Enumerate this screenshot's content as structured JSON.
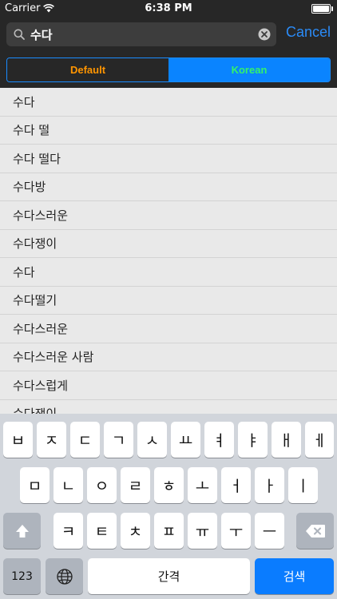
{
  "status_bar": {
    "carrier": "Carrier",
    "time": "6:38 PM"
  },
  "search": {
    "value": "수다",
    "cancel_label": "Cancel"
  },
  "segments": [
    {
      "label": "Default",
      "selected": false
    },
    {
      "label": "Korean",
      "selected": true
    }
  ],
  "results": [
    "수다",
    "수다 떨",
    "수다 떨다",
    "수다방",
    "수다스러운",
    "수다쟁이",
    "수다",
    "수다떨기",
    "수다스러운",
    "수다스러운 사람",
    "수다스럽게",
    "수다쟁이"
  ],
  "keyboard": {
    "row1": [
      "ㅂ",
      "ㅈ",
      "ㄷ",
      "ㄱ",
      "ㅅ",
      "ㅛ",
      "ㅕ",
      "ㅑ",
      "ㅐ",
      "ㅔ"
    ],
    "row2": [
      "ㅁ",
      "ㄴ",
      "ㅇ",
      "ㄹ",
      "ㅎ",
      "ㅗ",
      "ㅓ",
      "ㅏ",
      "ㅣ"
    ],
    "row3": [
      "ㅋ",
      "ㅌ",
      "ㅊ",
      "ㅍ",
      "ㅠ",
      "ㅜ",
      "ㅡ"
    ],
    "numbers_label": "123",
    "space_label": "간격",
    "search_label": "검색"
  },
  "colors": {
    "accent": "#0a84ff",
    "default_segment_text": "#ff9500",
    "korean_segment_text": "#34f26a"
  }
}
